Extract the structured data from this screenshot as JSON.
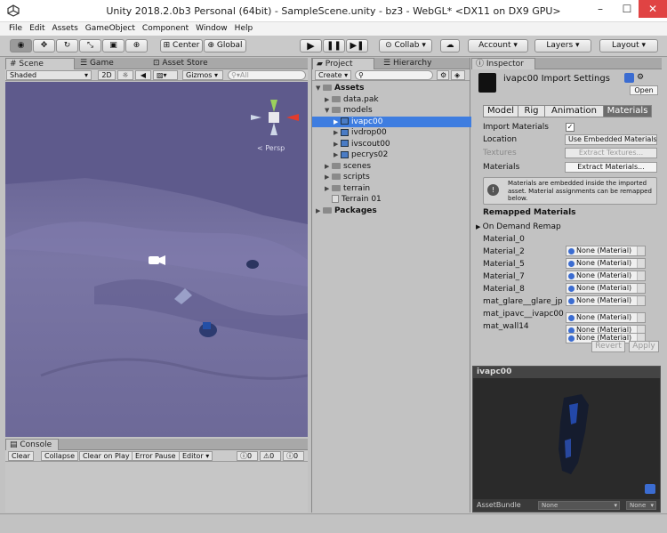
{
  "window": {
    "title": "Unity 2018.2.0b3 Personal (64bit) - SampleScene.unity - bz3 - WebGL* <DX11 on DX9 GPU>",
    "minimize": "–",
    "maximize": "☐",
    "close": "✕"
  },
  "menu": [
    "File",
    "Edit",
    "Assets",
    "GameObject",
    "Component",
    "Window",
    "Help"
  ],
  "toolbar": {
    "center": "Center",
    "global": "Global",
    "collab": "Collab ▾",
    "account": "Account ▾",
    "layers": "Layers ▾",
    "layout": "Layout ▾"
  },
  "scene": {
    "tabs": [
      "Scene",
      "Game",
      "Asset Store"
    ],
    "shading": "Shaded",
    "mode_2d": "2D",
    "gizmos": "Gizmos ▾",
    "search_placeholder": "All",
    "persp": "< Persp"
  },
  "console": {
    "tab": "Console",
    "buttons": [
      "Clear",
      "Collapse",
      "Clear on Play",
      "Error Pause",
      "Editor ▾"
    ],
    "counts": [
      "0",
      "0",
      "0"
    ]
  },
  "project": {
    "tabs": [
      "Project",
      "Hierarchy"
    ],
    "create": "Create ▾",
    "tree": [
      {
        "label": "Assets",
        "bold": true
      },
      {
        "label": "data.pak"
      },
      {
        "label": "models"
      },
      {
        "label": "ivapc00",
        "selected": true
      },
      {
        "label": "ivdrop00"
      },
      {
        "label": "ivscout00"
      },
      {
        "label": "pecrys02"
      },
      {
        "label": "scenes"
      },
      {
        "label": "scripts"
      },
      {
        "label": "terrain"
      },
      {
        "label": "Terrain 01"
      },
      {
        "label": "Packages",
        "bold": true
      }
    ]
  },
  "inspector": {
    "tab": "Inspector",
    "title": "ivapc00 Import Settings",
    "open": "Open",
    "tabs": [
      "Model",
      "Rig",
      "Animation",
      "Materials"
    ],
    "import_materials_label": "Import Materials",
    "location_label": "Location",
    "location_value": "Use Embedded Materials",
    "textures_label": "Textures",
    "extract_textures": "Extract Textures...",
    "materials_label": "Materials",
    "extract_materials": "Extract Materials...",
    "info": "Materials are embedded inside the imported asset. Material assignments can be remapped below.",
    "remapped_header": "Remapped Materials",
    "on_demand": "On Demand Remap",
    "materials": [
      {
        "name": "Material_0",
        "value": "None (Material)"
      },
      {
        "name": "Material_2",
        "value": "None (Material)"
      },
      {
        "name": "Material_5",
        "value": "None (Material)"
      },
      {
        "name": "Material_7",
        "value": "None (Material)"
      },
      {
        "name": "Material_8",
        "value": "None (Material)"
      },
      {
        "name": "mat_glare__glare_jp",
        "value": "None (Material)"
      },
      {
        "name": "mat_ipavc__ivapc00",
        "value": "None (Material)"
      },
      {
        "name": "mat_wall14",
        "value": "None (Material)"
      }
    ],
    "revert": "Revert",
    "apply": "Apply"
  },
  "preview": {
    "title": "ivapc00",
    "assetbundle_label": "AssetBundle",
    "bundle_value": "None",
    "variant_value": "None"
  }
}
